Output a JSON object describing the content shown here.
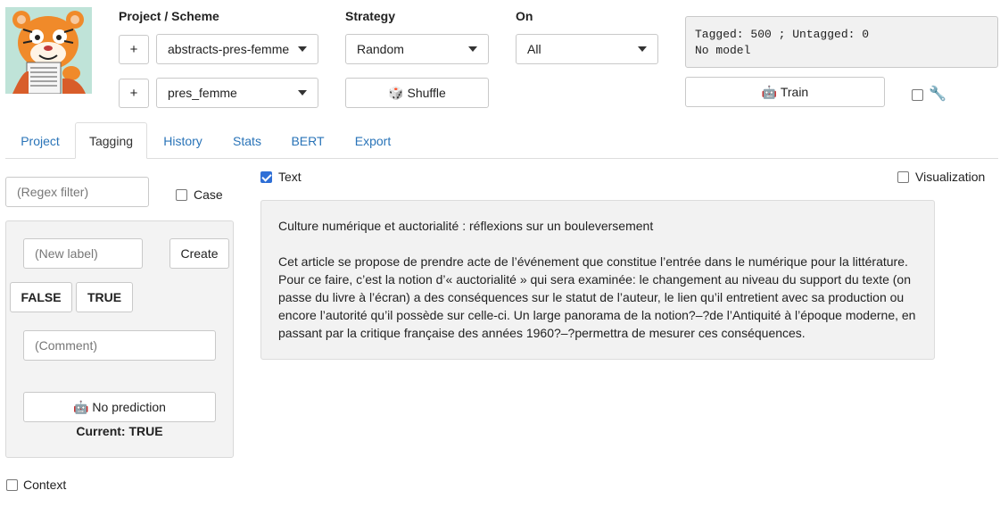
{
  "header": {
    "project_scheme_label": "Project / Scheme",
    "strategy_label": "Strategy",
    "on_label": "On",
    "add_project_symbol": "+",
    "add_scheme_symbol": "+",
    "project_value": "abstracts-pres-femme",
    "scheme_value": "pres_femme",
    "strategy_value": "Random",
    "on_value": "All",
    "shuffle_label": "🎲 Shuffle",
    "status_text": "Tagged: 500 ; Untagged: 0\nNo model",
    "train_label": "🤖 Train",
    "settings_icon": "🔧"
  },
  "tabs": [
    {
      "label": "Project"
    },
    {
      "label": "Tagging"
    },
    {
      "label": "History"
    },
    {
      "label": "Stats"
    },
    {
      "label": "BERT"
    },
    {
      "label": "Export"
    }
  ],
  "left": {
    "regex_placeholder": "(Regex filter)",
    "case_label": "Case",
    "new_label_placeholder": "(New label)",
    "create_label": "Create",
    "labels": [
      "FALSE",
      "TRUE"
    ],
    "comment_placeholder": "(Comment)",
    "prediction_label": "🤖 No prediction",
    "current_label": "Current: TRUE",
    "context_label": "Context"
  },
  "main": {
    "text_label": "Text",
    "visualization_label": "Visualization",
    "title": "Culture numérique et auctorialité : réflexions sur un bouleversement",
    "body": "Cet article se propose de prendre acte de l’événement que constitue l’entrée dans le numérique pour la littérature. Pour ce faire, c’est la notion d’« auctorialité » qui sera examinée: le changement au niveau du support du texte (on passe du livre à l’écran) a des conséquences sur le statut de l’auteur, le lien qu’il entretient avec sa production ou encore l’autorité qu’il possède sur celle-ci. Un large panorama de la notion?–?de l’Antiquité à l’époque moderne, en passant par la critique française des années 1960?–?permettra de mesurer ces conséquences."
  },
  "colors": {
    "link": "#2a74b8",
    "checkbox_checked": "#2f6fd6"
  }
}
